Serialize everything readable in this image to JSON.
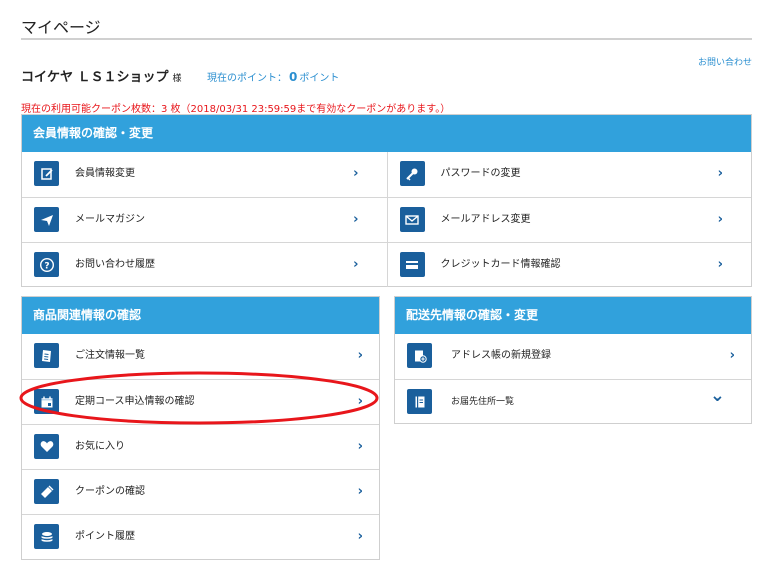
{
  "page": {
    "title": "マイページ",
    "contact_link": "お問い合わせ",
    "user_name": "コイケヤ ＬＳ１ショップ",
    "user_suffix": "様",
    "points_label": "現在のポイント：",
    "points_value": "0",
    "points_unit": "ポイント",
    "coupon_notice": "現在の利用可能クーポン枚数：3 枚（2018/03/31 23:59:59まで有効なクーポンがあります。）"
  },
  "member": {
    "heading": "会員情報の確認・変更",
    "left": [
      {
        "label": "会員情報変更",
        "icon": "edit-icon"
      },
      {
        "label": "メールマガジン",
        "icon": "paper-plane-icon"
      },
      {
        "label": "お問い合わせ履歴",
        "icon": "question-icon"
      }
    ],
    "right": [
      {
        "label": "パスワードの変更",
        "icon": "key-icon"
      },
      {
        "label": "メールアドレス変更",
        "icon": "envelope-icon"
      },
      {
        "label": "クレジットカード情報確認",
        "icon": "credit-card-icon"
      }
    ]
  },
  "products": {
    "heading": "商品関連情報の確認",
    "items": [
      {
        "label": "ご注文情報一覧",
        "icon": "order-list-icon"
      },
      {
        "label": "定期コース申込情報の確認",
        "icon": "calendar-icon"
      },
      {
        "label": "お気に入り",
        "icon": "heart-icon"
      },
      {
        "label": "クーポンの確認",
        "icon": "ticket-icon"
      },
      {
        "label": "ポイント履歴",
        "icon": "coins-icon"
      }
    ]
  },
  "shipping": {
    "heading": "配送先情報の確認・変更",
    "items": [
      {
        "label": "アドレス帳の新規登録",
        "icon": "add-address-icon",
        "arrow": "›"
      },
      {
        "label": "お届先住所一覧",
        "icon": "address-book-icon",
        "arrow": "⌄"
      }
    ]
  },
  "colors": {
    "header_bg": "#31a1dc",
    "icon_bg": "#1a5f9c",
    "link": "#2b8fd0",
    "notice": "#e8161b",
    "annotation": "#e8161b"
  }
}
